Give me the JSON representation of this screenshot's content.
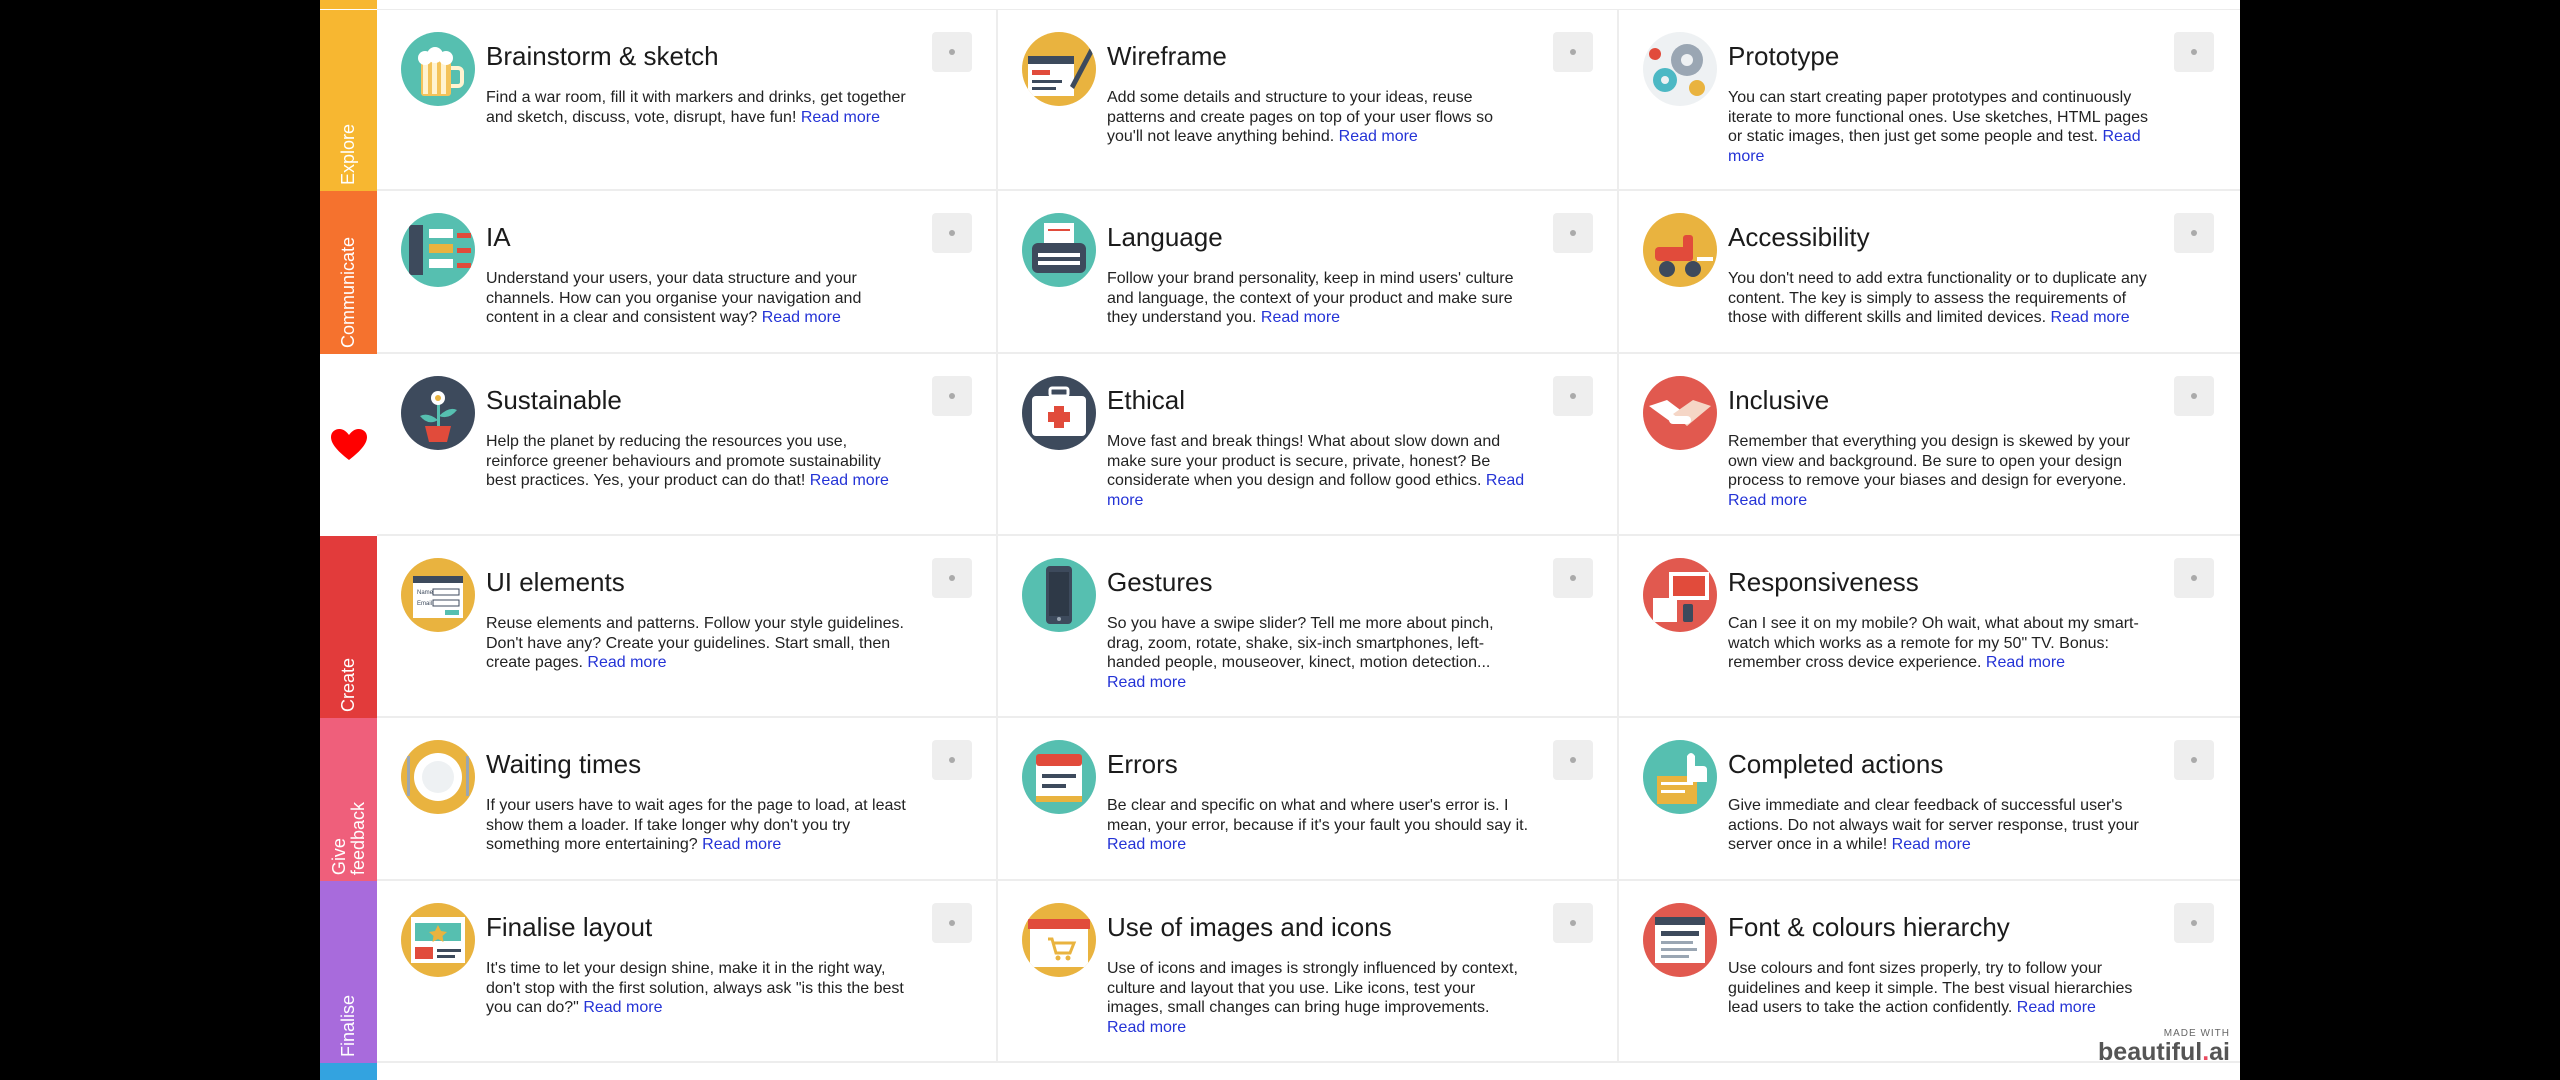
{
  "sections": [
    {
      "label": "Explore",
      "color": "#f7b731",
      "kind": "text"
    },
    {
      "label": "Communicate",
      "color": "#f5722e",
      "kind": "text"
    },
    {
      "label": "",
      "color": "#ffffff",
      "kind": "heart",
      "icon": "heart-icon",
      "icon_color": "#ff0000"
    },
    {
      "label": "Create",
      "color": "#e23b3b",
      "kind": "text"
    },
    {
      "label": "Give\nfeedback",
      "color": "#ef5f7b",
      "kind": "text"
    },
    {
      "label": "Finalise",
      "color": "#a86bdc",
      "kind": "text"
    }
  ],
  "bottom_strip_color": "#33a3e0",
  "read_more_label": "Read more",
  "cards": [
    [
      {
        "title": "Brainstorm & sketch",
        "desc": "Find a war room, fill it with markers and drinks, get together and sketch, discuss, vote, disrupt, have fun!",
        "icon": "beer-mug-icon"
      },
      {
        "title": "Wireframe",
        "desc": "Add some details and structure to your ideas, reuse patterns and create pages on top of your user flows so you'll not leave anything behind.",
        "icon": "wireframe-sketch-icon"
      },
      {
        "title": "Prototype",
        "desc": "You can start creating paper prototypes and continuously iterate to more functional ones. Use sketches, HTML pages or static images, then just get some people and test.",
        "icon": "gears-icon"
      }
    ],
    [
      {
        "title": "IA",
        "desc": "Understand your users, your data structure and your channels. How can you organise your navigation and content in a clear and consistent way?",
        "icon": "sitemap-icon"
      },
      {
        "title": "Language",
        "desc": "Follow your brand personality, keep in mind users' culture and language, the context of your product and make sure they understand you.",
        "icon": "typewriter-icon"
      },
      {
        "title": "Accessibility",
        "desc": "You don't need to add extra functionality or to duplicate any content. The key is simply to assess the requirements of those with different skills and limited devices.",
        "icon": "wheelchair-icon"
      }
    ],
    [
      {
        "title": "Sustainable",
        "desc": "Help the planet by reducing the resources you use, reinforce greener behaviours and promote sustainability best practices. Yes, your product can do that!",
        "icon": "plant-pot-icon"
      },
      {
        "title": "Ethical",
        "desc": "Move fast and break things! What about slow down and make sure your product is secure, private, honest? Be considerate when you design and follow good ethics.",
        "icon": "first-aid-kit-icon"
      },
      {
        "title": "Inclusive",
        "desc": "Remember that everything you design is skewed by your own view and background. Be sure to open your design process to remove your biases and design for everyone.",
        "icon": "handshake-icon"
      }
    ],
    [
      {
        "title": "UI elements",
        "desc": "Reuse elements and patterns. Follow your style guidelines. Don't have any? Create your guidelines. Start small, then create pages.",
        "icon": "form-icon",
        "icon_text": [
          "Name",
          "Email"
        ]
      },
      {
        "title": "Gestures",
        "desc": "So you have a swipe slider? Tell me more about pinch, drag, zoom, rotate, shake, six-inch smartphones, left-handed people, mouseover, kinect, motion detection...",
        "icon": "smartphone-icon"
      },
      {
        "title": "Responsiveness",
        "desc": "Can I see it on my mobile? Oh wait, what about my smart-watch which works as a remote for my 50\" TV. Bonus: remember cross device experience.",
        "icon": "devices-icon"
      }
    ],
    [
      {
        "title": "Waiting times",
        "desc": "If your users have to wait ages for the page to load, at least show them a loader. If take longer why don't you try something more entertaining?",
        "icon": "plate-icon"
      },
      {
        "title": "Errors",
        "desc": "Be clear and specific on what and where user's error is. I mean, your error, because if it's your fault you should say it.",
        "icon": "error-box-icon"
      },
      {
        "title": "Completed actions",
        "desc": "Give immediate and clear feedback of successful user's actions. Do not always wait for server response, trust your server once in a while!",
        "icon": "thumbs-up-icon"
      }
    ],
    [
      {
        "title": "Finalise layout",
        "desc": "It's time to let your design shine, make it in the right way, don't stop with the first solution, always ask \"is this the best you can do?\"",
        "icon": "layout-star-icon"
      },
      {
        "title": "Use of images and icons",
        "desc": "Use of icons and images is strongly influenced by context, culture and layout that you use. Like icons, test your images, small changes can bring huge improvements.",
        "icon": "shop-cart-icon"
      },
      {
        "title": "Font & colours hierarchy",
        "desc": "Use colours and font sizes properly, try to follow your guidelines and keep it simple. The best visual hierarchies lead users to take the action confidently.",
        "icon": "text-lines-icon"
      }
    ]
  ],
  "watermark": {
    "small": "MADE WITH",
    "brand": "beautiful",
    "dot": ".",
    "suffix": "ai"
  }
}
